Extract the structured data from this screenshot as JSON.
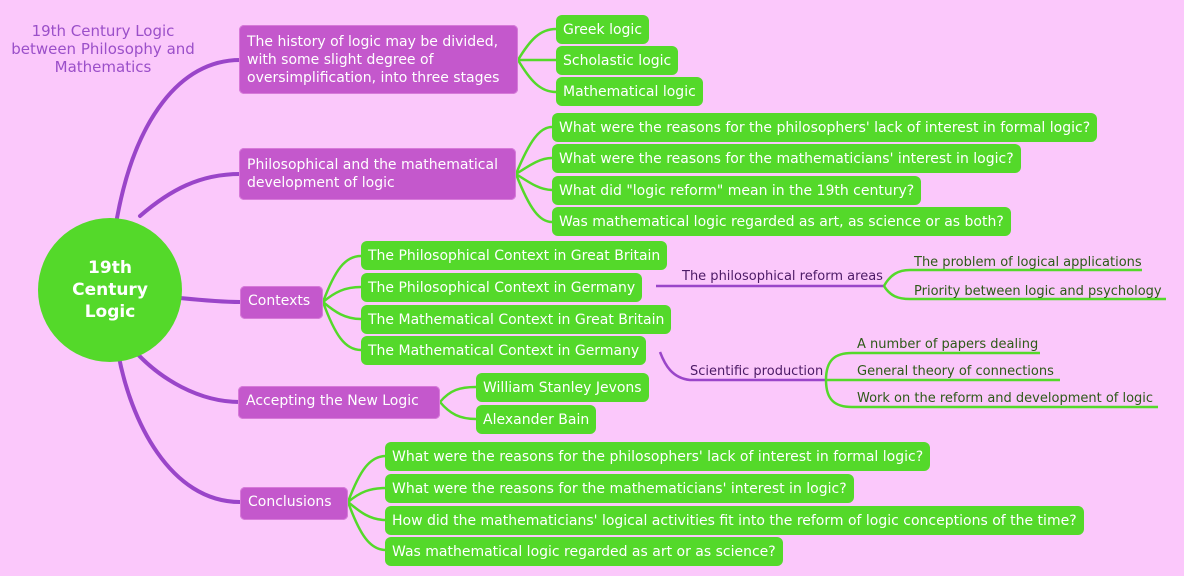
{
  "title": "19th Century Logic between Philosophy and Mathematics",
  "center": {
    "label": "19th Century Logic"
  },
  "colors": {
    "background": "#fbc8fb",
    "main_topic": "#c458cc",
    "subtopic": "#54d92a",
    "main_link": "#9a45c9",
    "sub_link": "#54d92a"
  },
  "topics": [
    {
      "label": "The history of logic may be divided, with some slight degree of oversimplification, into three stages",
      "children": [
        "Greek logic",
        "Scholastic logic",
        "Mathematical logic"
      ]
    },
    {
      "label": "Philosophical and the mathematical development of logic",
      "children": [
        "What were the reasons for the philosophers' lack of interest in formal logic?",
        "What were the reasons for the mathematicians' interest in logic?",
        "What did \"logic reform\" mean in the 19th century?",
        "Was mathematical logic regarded as art, as science or as both?"
      ]
    },
    {
      "label": "Contexts",
      "children": [
        "The Philosophical Context in Great Britain",
        "The Philosophical Context in Germany",
        "The Mathematical Context in Great Britain",
        "The Mathematical Context in Germany"
      ],
      "reform": {
        "label": "The philosophical reform areas",
        "children": [
          "The problem of logical applications",
          "Priority between logic and psychology"
        ]
      },
      "production": {
        "label": "Scientific production",
        "children": [
          "A number of papers dealing",
          "General theory of connections",
          "Work on the reform and development of logic"
        ]
      }
    },
    {
      "label": "Accepting the New Logic",
      "children": [
        "William Stanley Jevons",
        "Alexander Bain"
      ]
    },
    {
      "label": "Conclusions",
      "children": [
        "What were the reasons for the philosophers' lack of interest in formal logic?",
        "What were the reasons for the mathematicians' interest in logic?",
        "How did the mathematicians' logical activities fit into the reform of logic conceptions of the time?",
        "Was mathematical logic regarded as art or as science?"
      ]
    }
  ]
}
